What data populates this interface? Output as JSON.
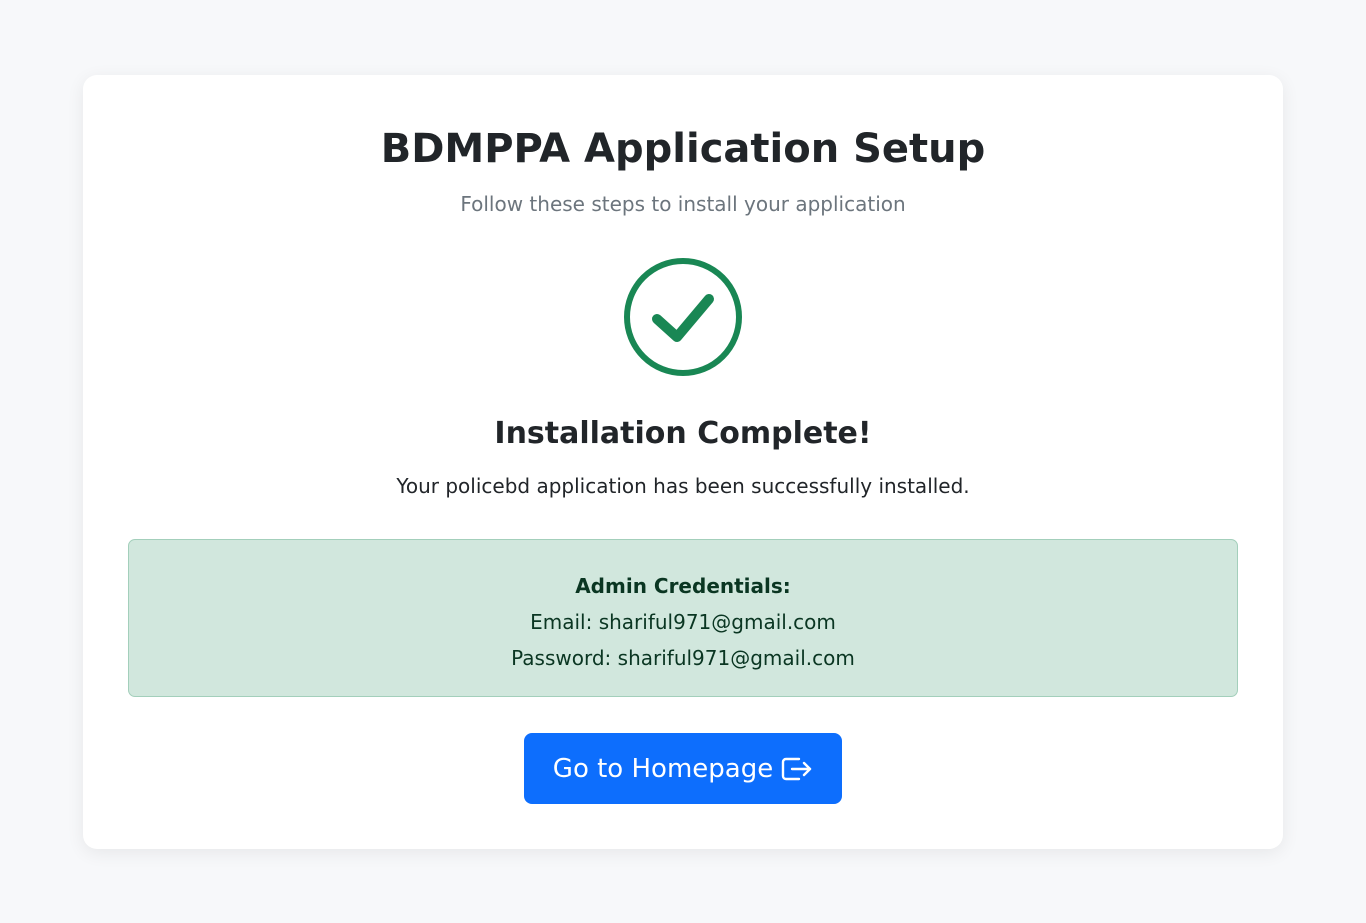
{
  "header": {
    "title": "BDMPPA Application Setup",
    "subtitle": "Follow these steps to install your application"
  },
  "status": {
    "icon": "check-circle-icon",
    "color": "#198754",
    "title": "Installation Complete!",
    "message": "Your policebd application has been successfully installed."
  },
  "credentials": {
    "heading": "Admin Credentials:",
    "email_line": "Email: shariful971@gmail.com",
    "password_line": "Password: shariful971@gmail.com",
    "background": "#d1e7dd"
  },
  "actions": {
    "homepage_label": "Go to Homepage",
    "homepage_icon": "box-arrow-right-icon",
    "button_color": "#0d6efd"
  }
}
